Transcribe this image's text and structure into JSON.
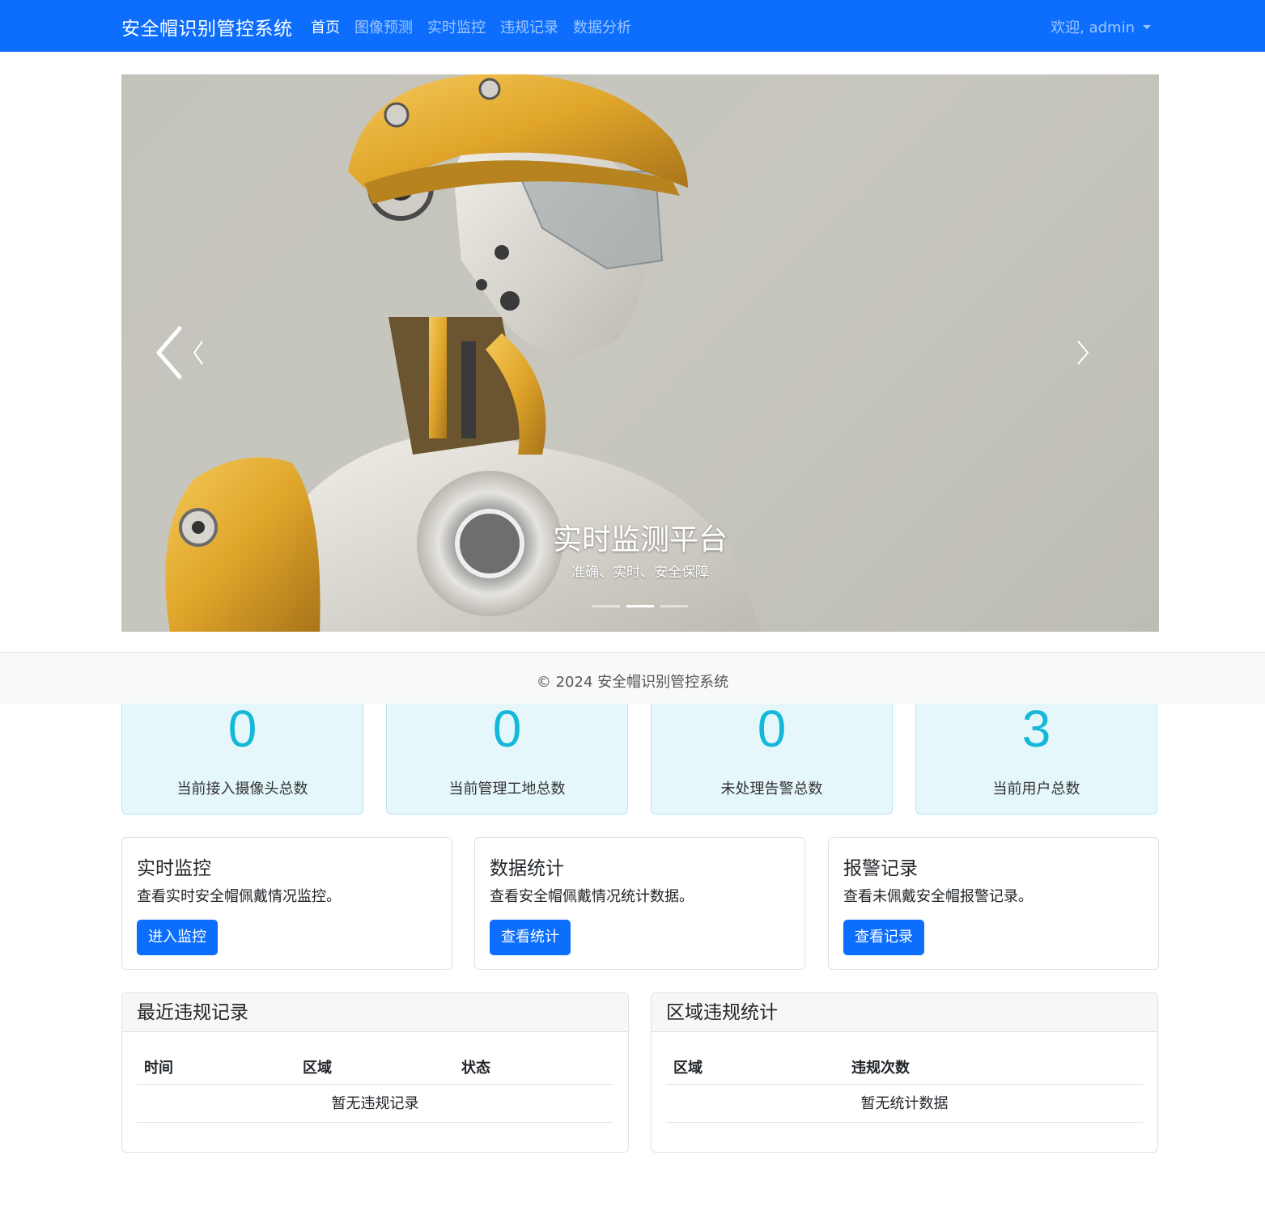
{
  "nav": {
    "brand": "安全帽识别管控系统",
    "items": [
      {
        "label": "首页",
        "active": true
      },
      {
        "label": "图像预测",
        "active": false
      },
      {
        "label": "实时监控",
        "active": false
      },
      {
        "label": "违规记录",
        "active": false
      },
      {
        "label": "数据分析",
        "active": false
      }
    ],
    "user": "欢迎, admin",
    "accent": "#0d6efd"
  },
  "carousel": {
    "caption_title": "实时监测平台",
    "caption_sub": "准确、实时、安全保障",
    "slide_count": 3,
    "active_index": 1,
    "prev_icon": "chevron-left-icon",
    "next_icon": "chevron-right-icon"
  },
  "footer": {
    "text": "© 2024 安全帽识别管控系统"
  },
  "stats": [
    {
      "value": "0",
      "label": "当前接入摄像头总数"
    },
    {
      "value": "0",
      "label": "当前管理工地总数"
    },
    {
      "value": "0",
      "label": "未处理告警总数"
    },
    {
      "value": "3",
      "label": "当前用户总数"
    }
  ],
  "features": [
    {
      "title": "实时监控",
      "desc": "查看实时安全帽佩戴情况监控。",
      "button": "进入监控"
    },
    {
      "title": "数据统计",
      "desc": "查看安全帽佩戴情况统计数据。",
      "button": "查看统计"
    },
    {
      "title": "报警记录",
      "desc": "查看未佩戴安全帽报警记录。",
      "button": "查看记录"
    }
  ],
  "recent": {
    "title": "最近违规记录",
    "columns": [
      "时间",
      "区域",
      "状态"
    ],
    "empty": "暂无违规记录"
  },
  "region": {
    "title": "区域违规统计",
    "columns": [
      "区域",
      "违规次数"
    ],
    "empty": "暂无统计数据"
  }
}
